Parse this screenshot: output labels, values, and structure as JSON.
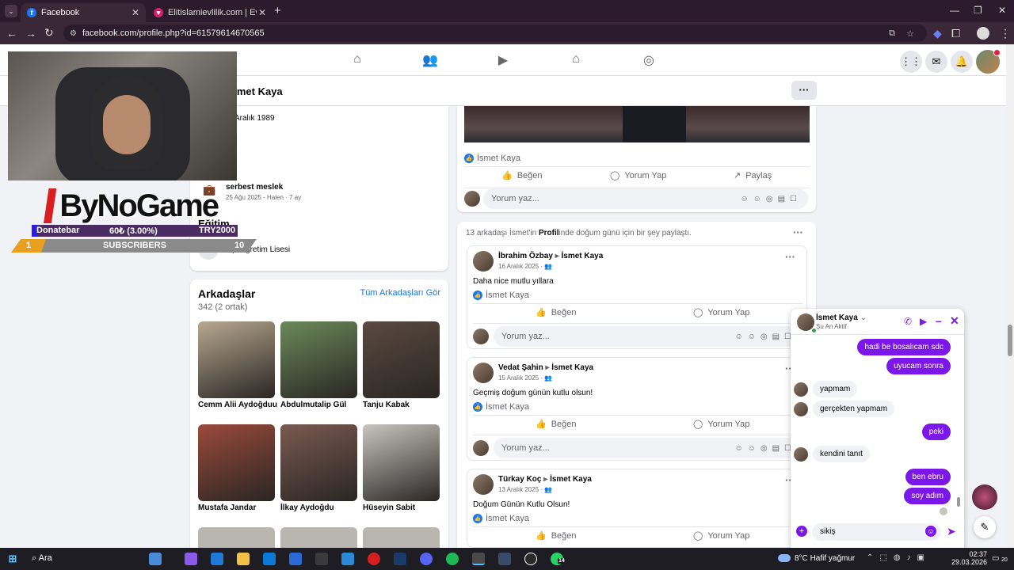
{
  "browser": {
    "tabs": [
      {
        "title": "Facebook",
        "active": true
      },
      {
        "title": "Elitislamievlilik.com | Evlilik Sitesi",
        "active": false
      }
    ],
    "new_tab_label": "+",
    "url": "facebook.com/profile.php?id=61579614670565"
  },
  "header": {
    "profile_name": "İsmet Kaya",
    "more_label": "···"
  },
  "overlay": {
    "logo_text": "ByNoGame",
    "donate_label": "Donatebar",
    "donate_amount": "60₺ (3.00%)",
    "donate_goal": "TRY2000",
    "donate_progress": 0.03,
    "subs_count": "1",
    "subs_label": "SUBSCRIBERS",
    "subs_goal": "10"
  },
  "intro": {
    "birthday": "Aralık 1989",
    "job_title": "serbest meslek",
    "job_date": "25 Ağu 2025 - Halen · 7 ay",
    "education_heading": "Eğitim",
    "school": "Açıköğretim Lisesi"
  },
  "friends": {
    "heading": "Arkadaşlar",
    "count": "342 (2 ortak)",
    "see_all": "Tüm Arkadaşları Gör",
    "items": [
      {
        "name": "Cemm Alii Aydoğduu",
        "color": "#b7a890"
      },
      {
        "name": "Abdulmutalip Gül",
        "color": "#6b8a5a"
      },
      {
        "name": "Tanju Kabak",
        "color": "#5a4a40"
      },
      {
        "name": "Mustafa Jandar",
        "color": "#9a4a3a"
      },
      {
        "name": "İlkay Aydoğdu",
        "color": "#7a5a50"
      },
      {
        "name": "Hüseyin Sabit",
        "color": "#c8c4be"
      }
    ]
  },
  "top_post": {
    "liker": "İsmet Kaya",
    "like": "Beğen",
    "comment": "Yorum Yap",
    "share": "Paylaş",
    "comment_placeholder": "Yorum yaz..."
  },
  "birthday_section": {
    "header_prefix": "13 arkadaşı İsmet'in ",
    "header_bold": "Profil",
    "header_suffix": "inde doğum günü için bir şey paylaştı.",
    "posts": [
      {
        "author": "İbrahim Özbay",
        "target": "İsmet Kaya",
        "date": "16 Aralık 2025 ·",
        "text": "Daha nice mutlu yıllara",
        "liker": "İsmet Kaya"
      },
      {
        "author": "Vedat Şahin",
        "target": "İsmet Kaya",
        "date": "15 Aralık 2025 ·",
        "text": "Geçmiş doğum günün kutlu olsun!",
        "liker": "İsmet Kaya"
      },
      {
        "author": "Türkay Koç",
        "target": "İsmet Kaya",
        "date": "13 Aralık 2025 ·",
        "text": "Doğum Günün Kutlu Olsun!",
        "liker": "İsmet Kaya"
      }
    ],
    "like": "Beğen",
    "comment": "Yorum Yap",
    "comment_placeholder": "Yorum yaz..."
  },
  "chat": {
    "name": "İsmet Kaya",
    "status": "Şu An Aktif",
    "messages": [
      {
        "from": "me",
        "text": "hadi be bosalıcam sdc"
      },
      {
        "from": "me",
        "text": "uyucam sonra"
      },
      {
        "from": "them",
        "text": "yapmam"
      },
      {
        "from": "them",
        "text": "gerçekten yapmam"
      },
      {
        "from": "me",
        "text": "peki"
      },
      {
        "from": "them",
        "text": "kendini tanıt"
      },
      {
        "from": "me",
        "text": "ben ebru"
      },
      {
        "from": "me",
        "text": "soy adım"
      }
    ],
    "input_value": "sikiş"
  },
  "taskbar": {
    "search_label": "Ara",
    "weather": "8°C",
    "weather_text": "Hafif yağmur",
    "time": "02:37",
    "date": "29.03.2026",
    "notif_count": "20",
    "whatsapp_badge": "14"
  },
  "colors": {
    "fb_blue": "#1877f2",
    "messenger_purple": "#7b17e8",
    "chrome_tab_bg": "#2b1b2c"
  }
}
